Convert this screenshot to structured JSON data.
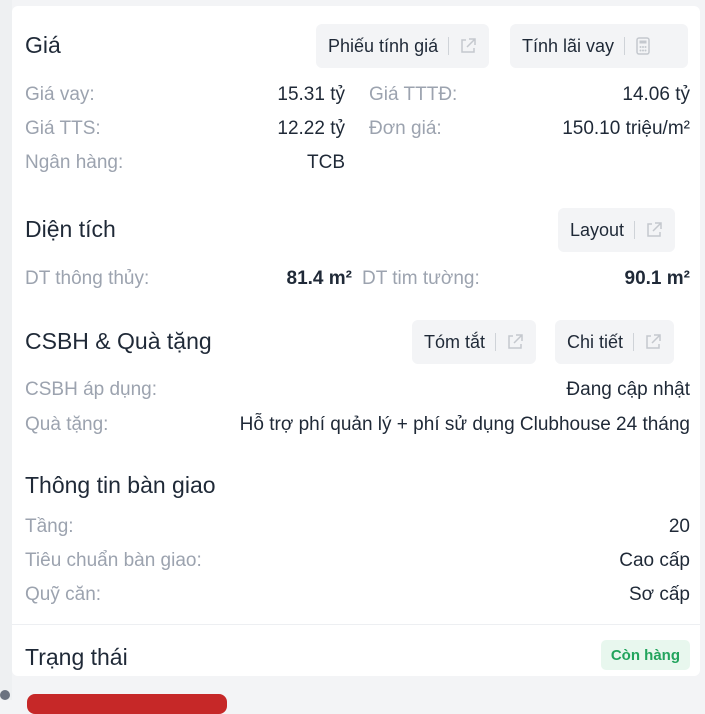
{
  "gia": {
    "title": "Giá",
    "phieu_tinh_gia_label": "Phiếu tính giá",
    "tinh_lai_vay_label": "Tính lãi vay",
    "gia_vay_label": "Giá vay:",
    "gia_vay_value": "15.31 tỷ",
    "gia_tttd_label": "Giá TTTĐ:",
    "gia_tttd_value": "14.06 tỷ",
    "gia_tts_label": "Giá TTS:",
    "gia_tts_value": "12.22 tỷ",
    "don_gia_label": "Đơn giá:",
    "don_gia_value": "150.10 triệu/m²",
    "ngan_hang_label": "Ngân hàng:",
    "ngan_hang_value": "TCB"
  },
  "dien_tich": {
    "title": "Diện tích",
    "layout_label": "Layout",
    "dt_thong_thuy_label": "DT thông thủy:",
    "dt_thong_thuy_value": "81.4 m²",
    "dt_tim_tuong_label": "DT tim tường:",
    "dt_tim_tuong_value": "90.1 m²"
  },
  "csbh": {
    "title": "CSBH & Quà tặng",
    "tom_tat_label": "Tóm tắt",
    "chi_tiet_label": "Chi tiết",
    "csbh_ap_dung_label": "CSBH áp dụng:",
    "csbh_ap_dung_value": "Đang cập nhật",
    "qua_tang_label": "Quà tặng:",
    "qua_tang_value": "Hỗ trợ phí quản lý + phí sử dụng Clubhouse 24 tháng"
  },
  "ban_giao": {
    "title": "Thông tin bàn giao",
    "tang_label": "Tầng:",
    "tang_value": "20",
    "tieu_chuan_label": "Tiêu chuẩn bàn giao:",
    "tieu_chuan_value": "Cao cấp",
    "quy_can_label": "Quỹ căn:",
    "quy_can_value": "Sơ cấp"
  },
  "trang_thai": {
    "title": "Trạng thái",
    "badge": "Còn hàng"
  },
  "icons": {
    "external_link": "external-link-icon",
    "calculator": "calculator-icon"
  },
  "colors": {
    "label_gray": "#9ca3af",
    "text_dark": "#1f2937",
    "badge_green": "#22a45d",
    "badge_bg": "#e8f7ee",
    "button_bg": "#f3f4f6"
  }
}
